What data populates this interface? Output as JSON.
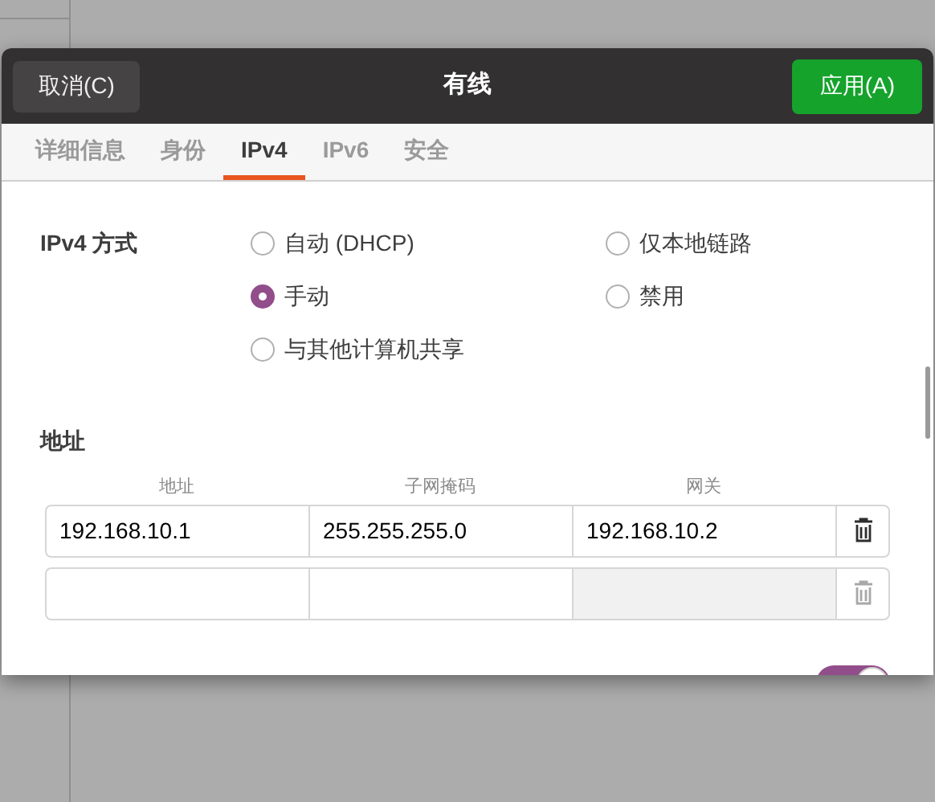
{
  "dialog": {
    "title": "有线",
    "cancel_button": "取消(C)",
    "apply_button": "应用(A)"
  },
  "tabs": [
    {
      "label": "详细信息",
      "selected": false
    },
    {
      "label": "身份",
      "selected": false
    },
    {
      "label": "IPv4",
      "selected": true
    },
    {
      "label": "IPv6",
      "selected": false
    },
    {
      "label": "安全",
      "selected": false
    }
  ],
  "method": {
    "label": "IPv4 方式",
    "options": [
      {
        "label": "自动 (DHCP)",
        "selected": false
      },
      {
        "label": "手动",
        "selected": true
      },
      {
        "label": "与其他计算机共享",
        "selected": false
      },
      {
        "label": "仅本地链路",
        "selected": false
      },
      {
        "label": "禁用",
        "selected": false
      }
    ]
  },
  "addresses": {
    "title": "地址",
    "columns": [
      "地址",
      "子网掩码",
      "网关"
    ],
    "rows": [
      {
        "cells": [
          "192.168.10.1",
          "255.255.255.0",
          "192.168.10.2"
        ],
        "gateway_disabled": false,
        "delete_disabled": false
      },
      {
        "cells": [
          "",
          "",
          ""
        ],
        "gateway_disabled": true,
        "delete_disabled": true
      }
    ]
  },
  "toggle": {
    "on": true
  }
}
